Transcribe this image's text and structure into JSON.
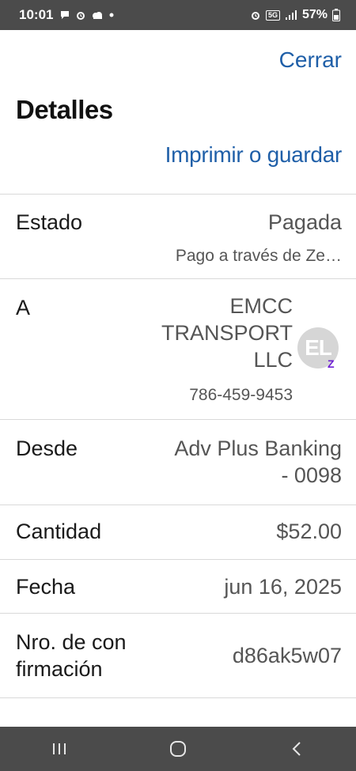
{
  "status_bar": {
    "time": "10:01",
    "network": "5G",
    "battery": "57%"
  },
  "header": {
    "close_label": "Cerrar",
    "title": "Detalles",
    "print_label": "Imprimir o guardar"
  },
  "details": {
    "status": {
      "label": "Estado",
      "value": "Pagada",
      "sub": "Pago a través de Ze…"
    },
    "to": {
      "label": "A",
      "name_line1": "EMCC",
      "name_line2": "TRANSPORT",
      "name_line3": "LLC",
      "phone": "786-459-9453",
      "avatar_initials": "EL",
      "avatar_badge": "Z"
    },
    "from": {
      "label": "Desde",
      "value_line1": "Adv Plus Banking",
      "value_line2": "- 0098"
    },
    "amount": {
      "label": "Cantidad",
      "value": "$52.00"
    },
    "date": {
      "label": "Fecha",
      "value": "jun 16, 2025"
    },
    "confirmation": {
      "label_line1": "Nro. de con",
      "label_line2": "firmación",
      "value": "d86ak5w07"
    }
  },
  "colors": {
    "link": "#1f5fa8",
    "system_bar": "#4b4b4b",
    "zelle_purple": "#6d1ed4"
  },
  "icons": {
    "status_left": [
      "chat-icon",
      "alarm-icon",
      "cloud-icon",
      "dot-icon"
    ],
    "status_right": [
      "alarm-icon",
      "signal-icon",
      "battery-icon"
    ],
    "nav": [
      "recents-icon",
      "home-icon",
      "back-icon"
    ]
  }
}
